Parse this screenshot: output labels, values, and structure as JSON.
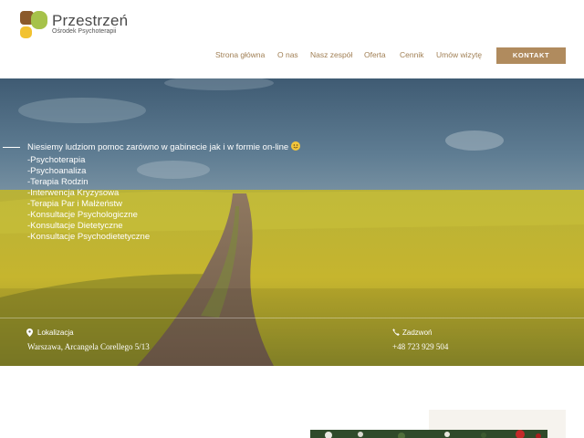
{
  "brand": {
    "name": "Przestrzeń",
    "subtitle": "Ośrodek Psychoterapii",
    "colors": {
      "accent": "#b08b5e",
      "logo_brown": "#8b5a2b",
      "logo_green": "#a6c24a",
      "logo_yellow": "#f2c230"
    }
  },
  "nav": {
    "items": [
      {
        "label": "Strona główna"
      },
      {
        "label": "O nas"
      },
      {
        "label": "Nasz zespół"
      },
      {
        "label": "Oferta"
      },
      {
        "label": "Cennik"
      },
      {
        "label": "Umów wizytę"
      }
    ],
    "cta_label": "KONTAKT"
  },
  "hero": {
    "intro": "Niesiemy ludziom pomoc zarówno w gabinecie jak i w formie on-line",
    "intro_icon": "smiley-emoji",
    "services": [
      "-Psychoterapia",
      "-Psychoanaliza",
      "-Terapia Rodzin",
      "-Interwencja Kryzysowa",
      "-Terapia Par i Małżeństw",
      "-Konsultacje Psychologiczne",
      "-Konsultacje Dietetyczne",
      "-Konsultacje Psychodietetyczne"
    ],
    "location": {
      "icon": "map-pin-icon",
      "label": "Lokalizacja",
      "value": "Warszawa, Arcangela Corellego 5/13"
    },
    "phone": {
      "icon": "phone-icon",
      "label": "Zadzwoń",
      "value": "+48 723 929 504"
    }
  }
}
